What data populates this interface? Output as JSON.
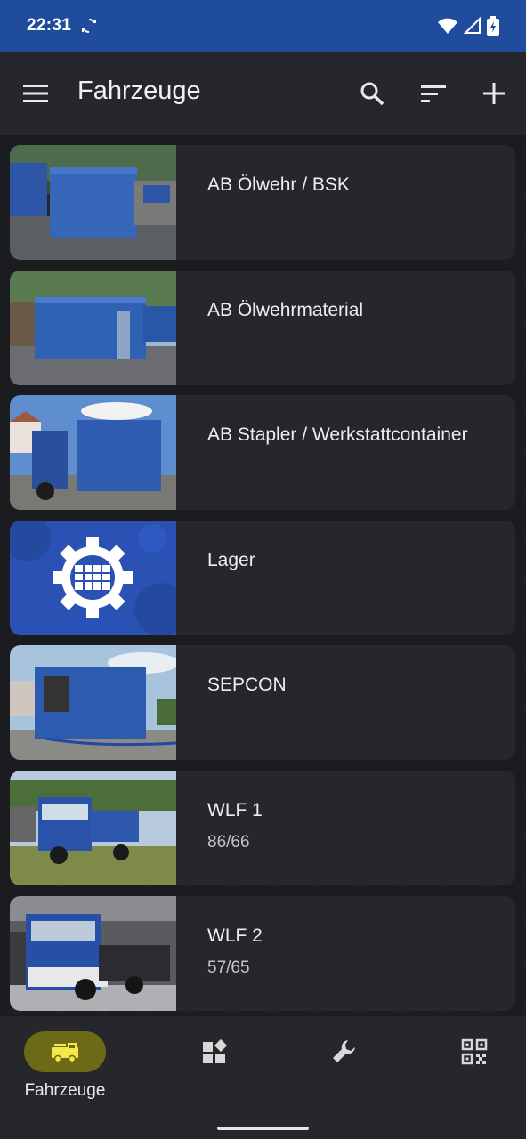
{
  "status_bar": {
    "time": "22:31",
    "icons": [
      "sync-icon",
      "wifi-icon",
      "signal-icon",
      "battery-charging-icon"
    ]
  },
  "app_bar": {
    "title": "Fahrzeuge",
    "actions": [
      "search-icon",
      "sort-icon",
      "add-icon"
    ]
  },
  "vehicles": [
    {
      "name": "AB Ölwehr / BSK",
      "subtitle": ""
    },
    {
      "name": "AB Ölwehrmaterial",
      "subtitle": ""
    },
    {
      "name": "AB Stapler / Werkstattcontainer",
      "subtitle": ""
    },
    {
      "name": "Lager",
      "subtitle": ""
    },
    {
      "name": "SEPCON",
      "subtitle": ""
    },
    {
      "name": "WLF 1",
      "subtitle": "86/66"
    },
    {
      "name": "WLF 2",
      "subtitle": "57/65"
    }
  ],
  "bottom_nav": {
    "items": [
      {
        "label": "Fahrzeuge",
        "icon": "fire-truck-icon",
        "active": true
      },
      {
        "label": "",
        "icon": "widgets-icon",
        "active": false
      },
      {
        "label": "",
        "icon": "wrench-icon",
        "active": false
      },
      {
        "label": "",
        "icon": "qr-code-icon",
        "active": false
      }
    ]
  },
  "colors": {
    "status_bar": "#1f4c9c",
    "surface": "#26272c",
    "background": "#1b1c20",
    "nav_active": "#6c6a17",
    "thw_blue": "#2a52b5"
  }
}
